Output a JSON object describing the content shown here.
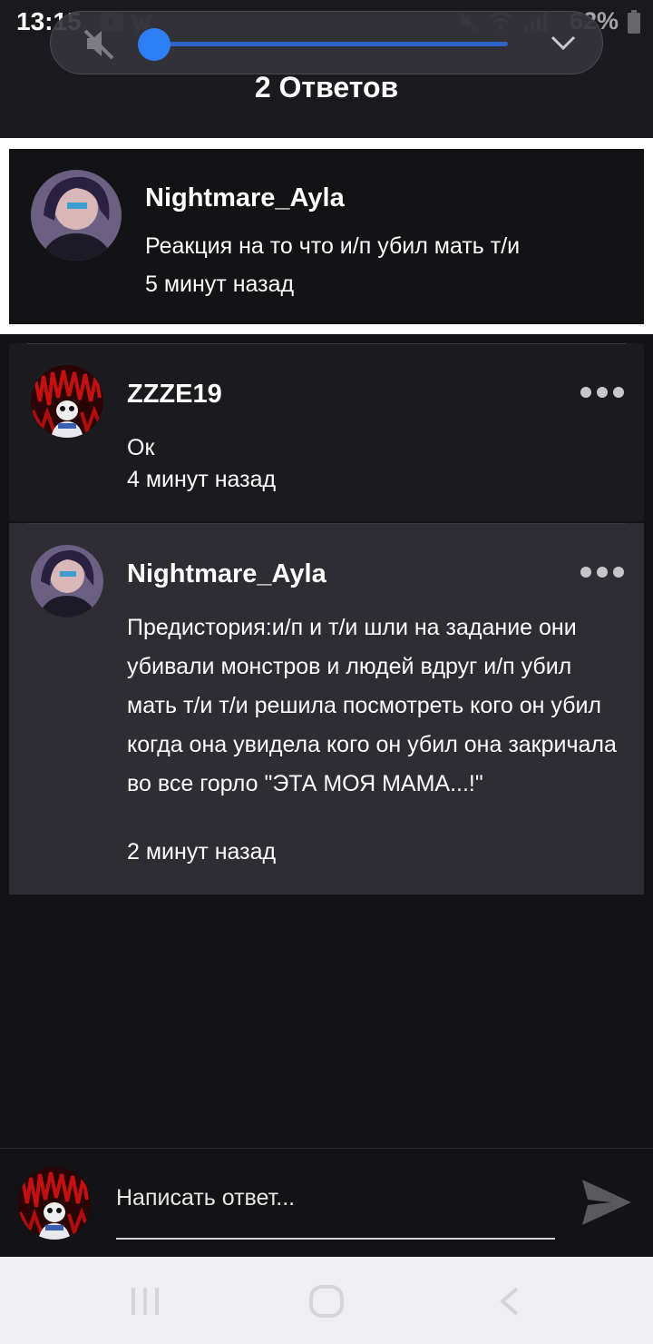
{
  "status_bar": {
    "time": "13:15",
    "battery": "62%"
  },
  "header": {
    "title": "2 Ответов"
  },
  "volume": {
    "level": 0.0,
    "muted": true
  },
  "main_post": {
    "author": "Nightmare_Ayla",
    "text": "Реакция на то что и/п убил мать т/и",
    "time": "5 минут назад"
  },
  "replies": [
    {
      "author": "ZZZE19",
      "text": "Ок",
      "time": "4 минут назад"
    },
    {
      "author": "Nightmare_Ayla",
      "text": "Предистория:и/п и т/и шли на задание они убивали монстров и людей вдруг и/п убил мать т/и т/и решила посмотреть кого он убил когда она увидела кого он убил она закричала во все горло \"ЭТА МОЯ МАМА...!\"",
      "time": "2 минут назад"
    }
  ],
  "compose": {
    "placeholder": "Написать ответ..."
  },
  "colors": {
    "background": "#131215",
    "accent": "#2d7df7",
    "highlight_reply": "#2e2d33"
  }
}
